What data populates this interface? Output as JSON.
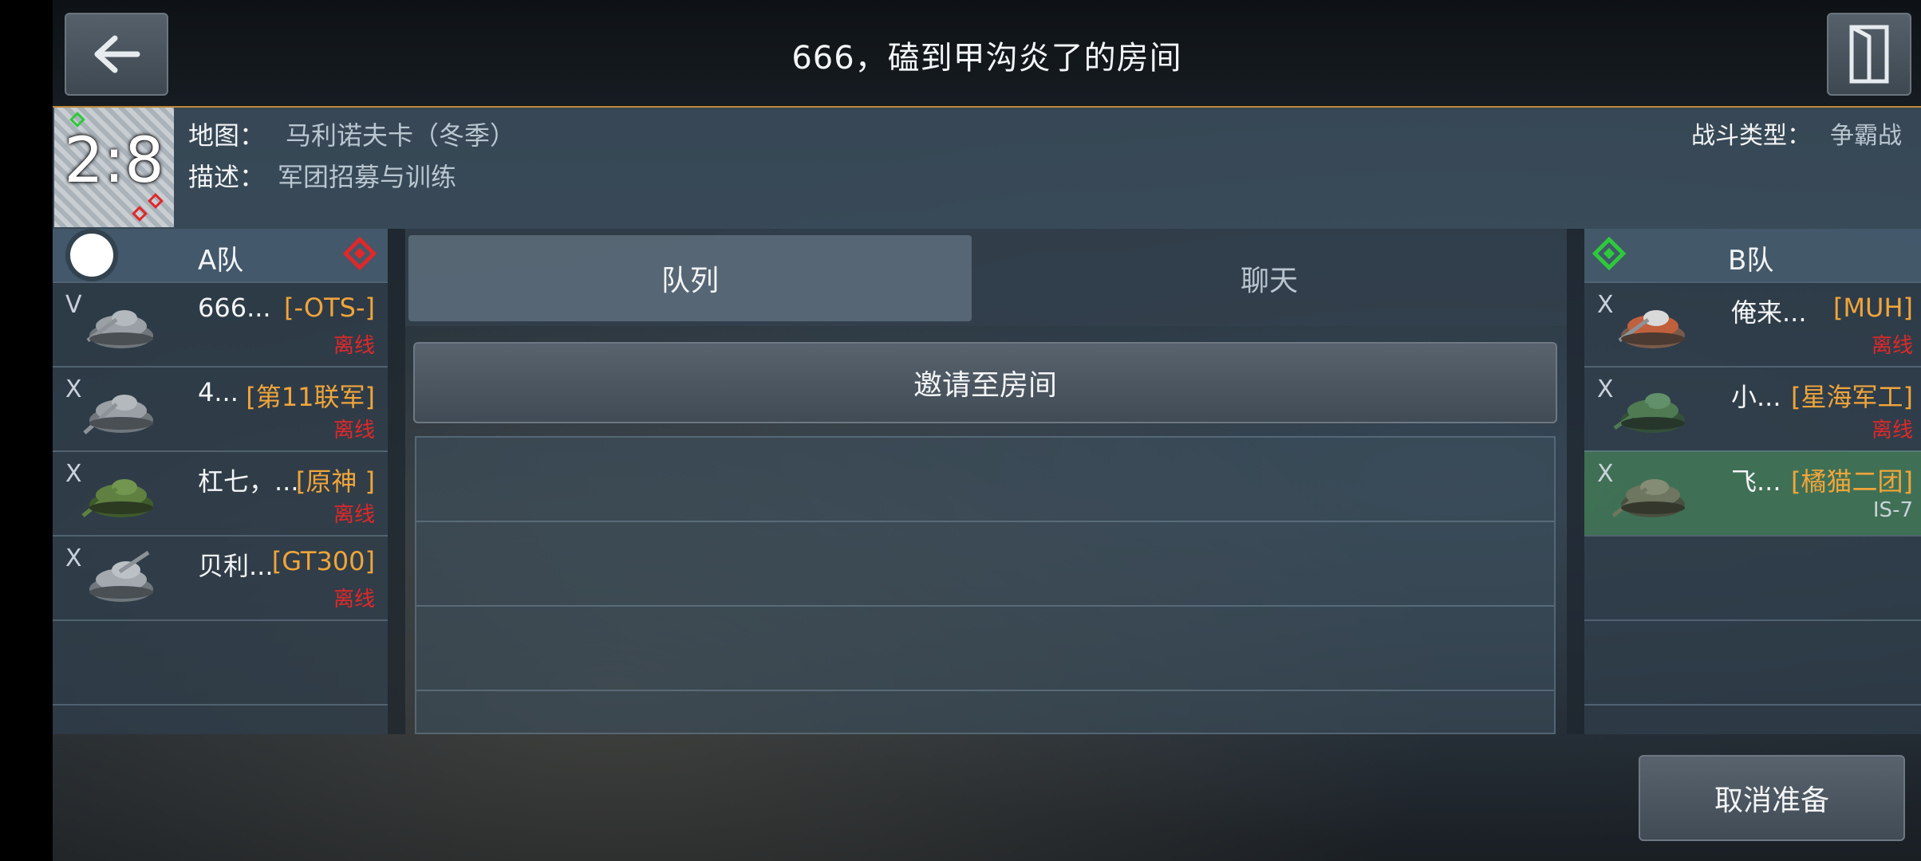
{
  "header": {
    "room_title": "666，磕到甲沟炎了的房间",
    "back_icon": "arrow-left-icon",
    "exit_icon": "exit-door-icon"
  },
  "info": {
    "map_label": "地图：",
    "map_value": "马利诺夫卡（冬季）",
    "desc_label": "描述：",
    "desc_value": "军团招募与训练",
    "battle_type_label": "战斗类型：",
    "battle_type_value": "争霸战",
    "minimap_ratio": "2:8"
  },
  "team_a": {
    "name": "A队",
    "color": "#e0282a",
    "players": [
      {
        "mark": "V",
        "name": "666...",
        "clan": "[-OTS-]",
        "status": "离线"
      },
      {
        "mark": "X",
        "name": "4...",
        "clan": "[第11联军]",
        "status": "离线"
      },
      {
        "mark": "X",
        "name": "杠七，...",
        "clan": "[原神 ]",
        "status": "离线"
      },
      {
        "mark": "X",
        "name": "贝利...",
        "clan": "[GT300]",
        "status": "离线"
      }
    ]
  },
  "team_b": {
    "name": "B队",
    "color": "#2ec93b",
    "players": [
      {
        "mark": "X",
        "name": "俺来...",
        "clan": "[MUH]",
        "status": "离线"
      },
      {
        "mark": "X",
        "name": "小...",
        "clan": "[星海军工]",
        "status": "离线"
      },
      {
        "mark": "X",
        "name": "飞...",
        "clan": "[橘猫二团]",
        "status": "IS-7"
      }
    ]
  },
  "middle": {
    "tab_queue": "队列",
    "tab_chat": "聊天",
    "invite_label": "邀请至房间"
  },
  "footer": {
    "cancel_ready_label": "取消准备"
  },
  "colors": {
    "accent": "#c08a3a",
    "clan": "#f0a53a",
    "offline": "#e0282a",
    "selected_row": "#488c5a"
  }
}
